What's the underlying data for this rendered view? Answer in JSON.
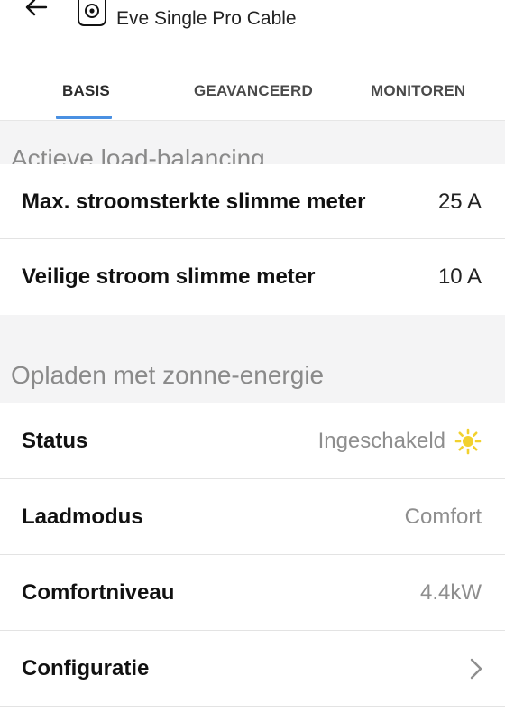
{
  "header": {
    "title": "Eve Single Pro Cable",
    "back_icon": "arrow-left-icon",
    "device_icon": "charger-icon"
  },
  "tabs": [
    {
      "label": "BASIS",
      "active": true
    },
    {
      "label": "GEAVANCEERD",
      "active": false
    },
    {
      "label": "MONITOREN",
      "active": false
    }
  ],
  "colors": {
    "accent": "#4a90e2",
    "sun": "#f2d12e"
  },
  "load_balancing": {
    "title": "Actieve load-balancing",
    "rows": [
      {
        "label": "Max. stroomsterkte slimme meter",
        "value": "25 A"
      },
      {
        "label": "Veilige stroom slimme meter",
        "value": "10 A"
      }
    ]
  },
  "solar": {
    "title": "Opladen met zonne-energie",
    "rows": [
      {
        "label": "Status",
        "value": "Ingeschakeld",
        "icon": "sun-icon"
      },
      {
        "label": "Laadmodus",
        "value": "Comfort"
      },
      {
        "label": "Comfortniveau",
        "value": "4.4kW"
      },
      {
        "label": "Configuratie",
        "icon": "chevron-right-icon"
      }
    ]
  }
}
